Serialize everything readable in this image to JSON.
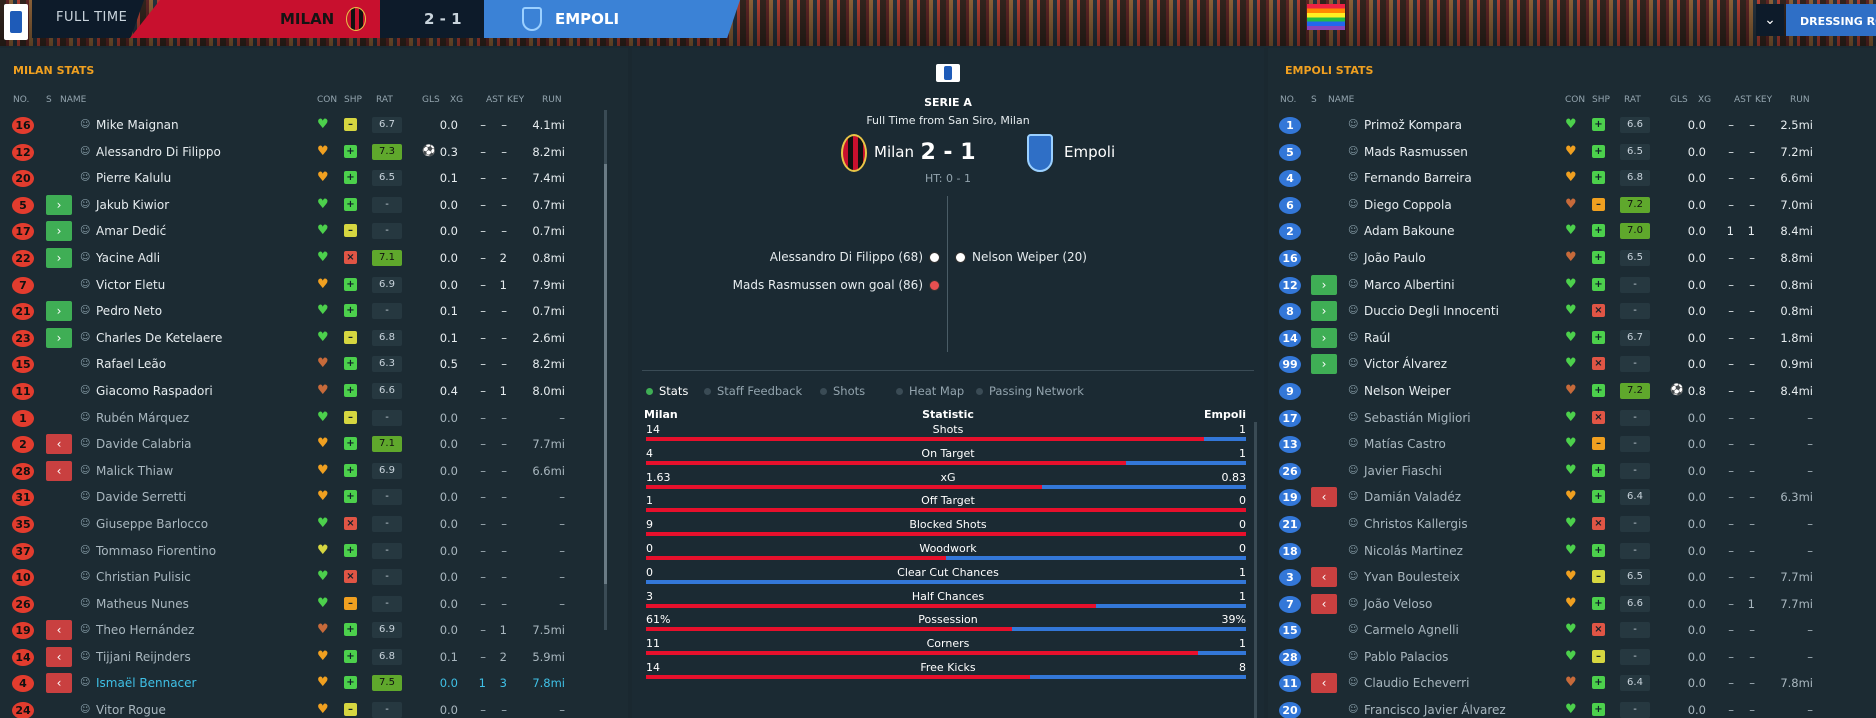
{
  "header": {
    "full_time": "FULL TIME",
    "home": "MILAN",
    "score": "2 - 1",
    "away": "EMPOLI",
    "dressing": "DRESSING RO",
    "dropdown_icon": "chevron-down-icon"
  },
  "columns": {
    "no": "NO.",
    "s": "S",
    "name": "NAME",
    "con": "CON",
    "shp": "SHP",
    "rat": "RAT",
    "gls": "GLS",
    "xg": "XG",
    "ast": "AST",
    "key": "KEY",
    "run": "RUN"
  },
  "left": {
    "title": "MILAN STATS",
    "players": [
      {
        "no": "16",
        "sub": "",
        "name": "Mike Maignan",
        "con": "green",
        "shp": "yellow",
        "rat": "6.7",
        "gls": "",
        "xg": "0.0",
        "ast": "–",
        "key": "–",
        "run": "4.1mi"
      },
      {
        "no": "12",
        "sub": "",
        "name": "Alessandro Di Filippo",
        "con": "orange",
        "shp": "green",
        "rat": "7.3",
        "gls": "ball",
        "xg": "0.3",
        "ast": "–",
        "key": "–",
        "run": "8.2mi"
      },
      {
        "no": "20",
        "sub": "",
        "name": "Pierre Kalulu",
        "con": "orange",
        "shp": "green",
        "rat": "6.5",
        "gls": "",
        "xg": "0.1",
        "ast": "–",
        "key": "–",
        "run": "7.4mi"
      },
      {
        "no": "5",
        "sub": "in",
        "name": "Jakub Kiwior",
        "con": "green",
        "shp": "green",
        "rat": "-",
        "gls": "",
        "xg": "0.0",
        "ast": "–",
        "key": "–",
        "run": "0.7mi"
      },
      {
        "no": "17",
        "sub": "in",
        "name": "Amar Dedić",
        "con": "green",
        "shp": "yellow",
        "rat": "-",
        "gls": "",
        "xg": "0.0",
        "ast": "–",
        "key": "–",
        "run": "0.7mi"
      },
      {
        "no": "22",
        "sub": "in",
        "name": "Yacine Adli",
        "con": "green",
        "shp": "red",
        "rat": "7.1",
        "gls": "",
        "xg": "0.0",
        "ast": "–",
        "key": "2",
        "run": "0.8mi"
      },
      {
        "no": "7",
        "sub": "",
        "name": "Victor Eletu",
        "con": "orange",
        "shp": "green",
        "rat": "6.9",
        "gls": "",
        "xg": "0.0",
        "ast": "–",
        "key": "1",
        "run": "7.9mi"
      },
      {
        "no": "21",
        "sub": "in",
        "name": "Pedro Neto",
        "con": "green",
        "shp": "green",
        "rat": "-",
        "gls": "",
        "xg": "0.1",
        "ast": "–",
        "key": "–",
        "run": "0.7mi"
      },
      {
        "no": "23",
        "sub": "in",
        "name": "Charles De Ketelaere",
        "con": "green",
        "shp": "yellow",
        "rat": "6.8",
        "gls": "",
        "xg": "0.1",
        "ast": "–",
        "key": "–",
        "run": "2.6mi"
      },
      {
        "no": "15",
        "sub": "",
        "name": "Rafael Leão",
        "con": "brown",
        "shp": "green",
        "rat": "6.3",
        "gls": "",
        "xg": "0.5",
        "ast": "–",
        "key": "–",
        "run": "8.2mi"
      },
      {
        "no": "11",
        "sub": "",
        "name": "Giacomo Raspadori",
        "con": "brown",
        "shp": "green",
        "rat": "6.6",
        "gls": "",
        "xg": "0.4",
        "ast": "–",
        "key": "1",
        "run": "8.0mi"
      },
      {
        "no": "1",
        "sub": "",
        "name": "Rubén Márquez",
        "con": "green",
        "shp": "yellow",
        "rat": "-",
        "gls": "",
        "xg": "0.0",
        "ast": "–",
        "key": "–",
        "run": "–",
        "bench": true
      },
      {
        "no": "2",
        "sub": "out",
        "name": "Davide Calabria",
        "con": "orange",
        "shp": "green",
        "rat": "7.1",
        "gls": "",
        "xg": "0.0",
        "ast": "–",
        "key": "–",
        "run": "7.7mi",
        "bench": true
      },
      {
        "no": "28",
        "sub": "out",
        "name": "Malick Thiaw",
        "con": "orange",
        "shp": "green",
        "rat": "6.9",
        "gls": "",
        "xg": "0.0",
        "ast": "–",
        "key": "–",
        "run": "6.6mi",
        "bench": true
      },
      {
        "no": "31",
        "sub": "",
        "name": "Davide Serretti",
        "con": "orange",
        "shp": "green",
        "rat": "-",
        "gls": "",
        "xg": "0.0",
        "ast": "–",
        "key": "–",
        "run": "–",
        "bench": true
      },
      {
        "no": "35",
        "sub": "",
        "name": "Giuseppe Barlocco",
        "con": "green",
        "shp": "red",
        "rat": "-",
        "gls": "",
        "xg": "0.0",
        "ast": "–",
        "key": "–",
        "run": "–",
        "bench": true
      },
      {
        "no": "37",
        "sub": "",
        "name": "Tommaso Fiorentino",
        "con": "yellow",
        "shp": "green",
        "rat": "-",
        "gls": "",
        "xg": "0.0",
        "ast": "–",
        "key": "–",
        "run": "–",
        "bench": true
      },
      {
        "no": "10",
        "sub": "",
        "name": "Christian Pulisic",
        "con": "green",
        "shp": "red",
        "rat": "-",
        "gls": "",
        "xg": "0.0",
        "ast": "–",
        "key": "–",
        "run": "–",
        "bench": true
      },
      {
        "no": "26",
        "sub": "",
        "name": "Matheus Nunes",
        "con": "green",
        "shp": "orange",
        "rat": "-",
        "gls": "",
        "xg": "0.0",
        "ast": "–",
        "key": "–",
        "run": "–",
        "bench": true
      },
      {
        "no": "19",
        "sub": "out",
        "name": "Theo Hernández",
        "con": "brown",
        "shp": "green",
        "rat": "6.9",
        "gls": "",
        "xg": "0.0",
        "ast": "–",
        "key": "1",
        "run": "7.5mi",
        "bench": true
      },
      {
        "no": "14",
        "sub": "out",
        "name": "Tijjani Reijnders",
        "con": "orange",
        "shp": "green",
        "rat": "6.8",
        "gls": "",
        "xg": "0.1",
        "ast": "–",
        "key": "2",
        "run": "5.9mi",
        "bench": true
      },
      {
        "no": "4",
        "sub": "out",
        "name": "Ismaël Bennacer",
        "con": "orange",
        "shp": "green",
        "rat": "7.5",
        "gls": "",
        "xg": "0.0",
        "ast": "1",
        "key": "3",
        "run": "7.8mi",
        "hl": true
      },
      {
        "no": "24",
        "sub": "",
        "name": "Vitor Rogue",
        "con": "orange",
        "shp": "yellow",
        "rat": "-",
        "gls": "",
        "xg": "0.0",
        "ast": "–",
        "key": "–",
        "run": "–",
        "bench": true
      }
    ]
  },
  "right": {
    "title": "EMPOLI STATS",
    "players": [
      {
        "no": "1",
        "sub": "",
        "name": "Primož Kompara",
        "con": "green",
        "shp": "green",
        "rat": "6.6",
        "gls": "",
        "xg": "0.0",
        "ast": "–",
        "key": "–",
        "run": "2.5mi"
      },
      {
        "no": "5",
        "sub": "",
        "name": "Mads Rasmussen",
        "con": "orange",
        "shp": "green",
        "rat": "6.5",
        "gls": "",
        "xg": "0.0",
        "ast": "–",
        "key": "–",
        "run": "7.2mi"
      },
      {
        "no": "4",
        "sub": "",
        "name": "Fernando Barreira",
        "con": "orange",
        "shp": "green",
        "rat": "6.8",
        "gls": "",
        "xg": "0.0",
        "ast": "–",
        "key": "–",
        "run": "6.6mi"
      },
      {
        "no": "6",
        "sub": "",
        "name": "Diego Coppola",
        "con": "brown",
        "shp": "orange",
        "rat": "7.2",
        "gls": "",
        "xg": "0.0",
        "ast": "–",
        "key": "–",
        "run": "7.0mi"
      },
      {
        "no": "2",
        "sub": "",
        "name": "Adam Bakoune",
        "con": "green",
        "shp": "green",
        "rat": "7.0",
        "gls": "",
        "xg": "0.0",
        "ast": "1",
        "key": "1",
        "run": "8.4mi"
      },
      {
        "no": "16",
        "sub": "",
        "name": "João Paulo",
        "con": "brown",
        "shp": "green",
        "rat": "6.5",
        "gls": "",
        "xg": "0.0",
        "ast": "–",
        "key": "–",
        "run": "8.8mi"
      },
      {
        "no": "12",
        "sub": "in",
        "name": "Marco Albertini",
        "con": "green",
        "shp": "green",
        "rat": "-",
        "gls": "",
        "xg": "0.0",
        "ast": "–",
        "key": "–",
        "run": "0.8mi"
      },
      {
        "no": "8",
        "sub": "in",
        "name": "Duccio Degli Innocenti",
        "con": "green",
        "shp": "red",
        "rat": "-",
        "gls": "",
        "xg": "0.0",
        "ast": "–",
        "key": "–",
        "run": "0.8mi"
      },
      {
        "no": "14",
        "sub": "in",
        "name": "Raúl",
        "con": "green",
        "shp": "green",
        "rat": "6.7",
        "gls": "",
        "xg": "0.0",
        "ast": "–",
        "key": "–",
        "run": "1.8mi"
      },
      {
        "no": "99",
        "sub": "in",
        "name": "Victor Álvarez",
        "con": "green",
        "shp": "red",
        "rat": "-",
        "gls": "",
        "xg": "0.0",
        "ast": "–",
        "key": "–",
        "run": "0.9mi"
      },
      {
        "no": "9",
        "sub": "",
        "name": "Nelson Weiper",
        "con": "brown",
        "shp": "green",
        "rat": "7.2",
        "gls": "ball",
        "xg": "0.8",
        "ast": "–",
        "key": "–",
        "run": "8.4mi"
      },
      {
        "no": "17",
        "sub": "",
        "name": "Sebastián Migliori",
        "con": "green",
        "shp": "red",
        "rat": "-",
        "gls": "",
        "xg": "0.0",
        "ast": "–",
        "key": "–",
        "run": "–",
        "bench": true
      },
      {
        "no": "13",
        "sub": "",
        "name": "Matías Castro",
        "con": "green",
        "shp": "orange",
        "rat": "-",
        "gls": "",
        "xg": "0.0",
        "ast": "–",
        "key": "–",
        "run": "–",
        "bench": true
      },
      {
        "no": "26",
        "sub": "",
        "name": "Javier Fiaschi",
        "con": "green",
        "shp": "green",
        "rat": "-",
        "gls": "",
        "xg": "0.0",
        "ast": "–",
        "key": "–",
        "run": "–",
        "bench": true
      },
      {
        "no": "19",
        "sub": "out",
        "name": "Damián Valadéz",
        "con": "orange",
        "shp": "green",
        "rat": "6.4",
        "gls": "",
        "xg": "0.0",
        "ast": "–",
        "key": "–",
        "run": "6.3mi",
        "bench": true
      },
      {
        "no": "21",
        "sub": "",
        "name": "Christos Kallergis",
        "con": "green",
        "shp": "red",
        "rat": "-",
        "gls": "",
        "xg": "0.0",
        "ast": "–",
        "key": "–",
        "run": "–",
        "bench": true
      },
      {
        "no": "18",
        "sub": "",
        "name": "Nicolás Martinez",
        "con": "green",
        "shp": "green",
        "rat": "-",
        "gls": "",
        "xg": "0.0",
        "ast": "–",
        "key": "–",
        "run": "–",
        "bench": true
      },
      {
        "no": "3",
        "sub": "out",
        "name": "Yvan Boulesteix",
        "con": "orange",
        "shp": "yellow",
        "rat": "6.5",
        "gls": "",
        "xg": "0.0",
        "ast": "–",
        "key": "–",
        "run": "7.7mi",
        "bench": true
      },
      {
        "no": "7",
        "sub": "out",
        "name": "João Veloso",
        "con": "orange",
        "shp": "green",
        "rat": "6.6",
        "gls": "",
        "xg": "0.0",
        "ast": "–",
        "key": "1",
        "run": "7.7mi",
        "bench": true
      },
      {
        "no": "15",
        "sub": "",
        "name": "Carmelo Agnelli",
        "con": "green",
        "shp": "red",
        "rat": "-",
        "gls": "",
        "xg": "0.0",
        "ast": "–",
        "key": "–",
        "run": "–",
        "bench": true
      },
      {
        "no": "28",
        "sub": "",
        "name": "Pablo Palacios",
        "con": "green",
        "shp": "yellow",
        "rat": "-",
        "gls": "",
        "xg": "0.0",
        "ast": "–",
        "key": "–",
        "run": "–",
        "bench": true
      },
      {
        "no": "11",
        "sub": "out",
        "name": "Claudio Echeverri",
        "con": "brown",
        "shp": "green",
        "rat": "6.4",
        "gls": "",
        "xg": "0.0",
        "ast": "–",
        "key": "–",
        "run": "7.8mi",
        "bench": true
      },
      {
        "no": "20",
        "sub": "",
        "name": "Francisco Javier Álvarez",
        "con": "green",
        "shp": "green",
        "rat": "-",
        "gls": "",
        "xg": "0.0",
        "ast": "–",
        "key": "–",
        "run": "–",
        "bench": true
      }
    ]
  },
  "center": {
    "competition": "SERIE A",
    "venue": "Full Time from San Siro, Milan",
    "home": "Milan",
    "away": "Empoli",
    "score": "2 - 1",
    "ht": "HT: 0 - 1",
    "home_events": [
      "Alessandro Di Filippo (68)",
      "Mads Rasmussen own goal (86)"
    ],
    "away_events": [
      "Nelson Weiper (20)"
    ],
    "tabs": [
      "Stats",
      "Staff Feedback",
      "Shots",
      "Heat Map",
      "Passing Network"
    ],
    "stats_head": {
      "home": "Milan",
      "mid": "Statistic",
      "away": "Empoli"
    },
    "stats": [
      {
        "home": "14",
        "label": "Shots",
        "away": "1",
        "home_share": 0.93
      },
      {
        "home": "4",
        "label": "On Target",
        "away": "1",
        "home_share": 0.8
      },
      {
        "home": "1.63",
        "label": "xG",
        "away": "0.83",
        "home_share": 0.66
      },
      {
        "home": "1",
        "label": "Off Target",
        "away": "0",
        "home_share": 1.0
      },
      {
        "home": "9",
        "label": "Blocked Shots",
        "away": "0",
        "home_share": 1.0
      },
      {
        "home": "0",
        "label": "Woodwork",
        "away": "0",
        "home_share": 0.5
      },
      {
        "home": "0",
        "label": "Clear Cut Chances",
        "away": "1",
        "home_share": 0.0
      },
      {
        "home": "3",
        "label": "Half Chances",
        "away": "1",
        "home_share": 0.75
      },
      {
        "home": "61%",
        "label": "Possession",
        "away": "39%",
        "home_share": 0.61
      },
      {
        "home": "11",
        "label": "Corners",
        "away": "1",
        "home_share": 0.92
      },
      {
        "home": "14",
        "label": "Free Kicks",
        "away": "8",
        "home_share": 0.64
      }
    ]
  },
  "colors": {
    "milan": "#c8102e",
    "empoli": "#3b82d6",
    "accent_title": "#f0a020",
    "green": "#4cd04c",
    "orange": "#f0a020",
    "yellow": "#d6d640",
    "red": "#e05545",
    "brown": "#c76a3a"
  }
}
